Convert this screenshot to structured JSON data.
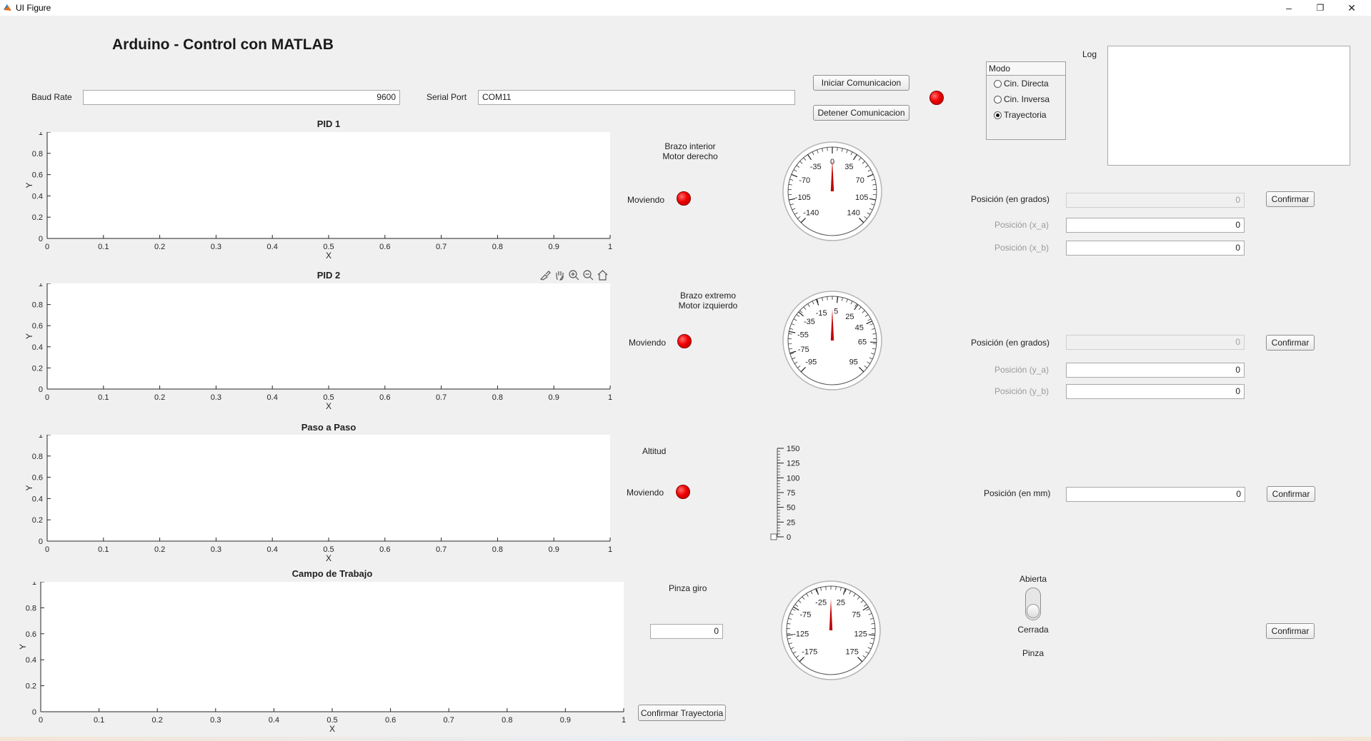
{
  "window": {
    "title": "UI Figure",
    "controls": {
      "minimize": "–",
      "maximize": "❐",
      "close": "✕"
    }
  },
  "app_title": "Arduino - Control con MATLAB",
  "connection": {
    "baud_label": "Baud Rate",
    "baud_value": "9600",
    "port_label": "Serial Port",
    "port_value": "COM11",
    "start_button": "Iniciar Comunicacion",
    "stop_button": "Detener Comunicacion"
  },
  "mode_panel": {
    "title": "Modo",
    "options": [
      "Cin. Directa",
      "Cin. Inversa",
      "Trayectoria"
    ],
    "selected": "Trayectoria"
  },
  "log": {
    "label": "Log",
    "content": ""
  },
  "plots": [
    {
      "title": "PID 1",
      "xlabel": "X",
      "ylabel": "Y"
    },
    {
      "title": "PID 2",
      "xlabel": "X",
      "ylabel": "Y"
    },
    {
      "title": "Paso a Paso",
      "xlabel": "X",
      "ylabel": "Y"
    },
    {
      "title": "Campo de Trabajo",
      "xlabel": "X",
      "ylabel": "Y"
    }
  ],
  "chart_data": [
    {
      "type": "line",
      "title": "PID 1",
      "xlabel": "X",
      "ylabel": "Y",
      "xlim": [
        0,
        1
      ],
      "ylim": [
        0,
        1
      ],
      "series": [],
      "xticks": [
        "0",
        "0.1",
        "0.2",
        "0.3",
        "0.4",
        "0.5",
        "0.6",
        "0.7",
        "0.8",
        "0.9",
        "1"
      ],
      "yticks": [
        "0",
        "0.2",
        "0.4",
        "0.6",
        "0.8",
        "1"
      ]
    },
    {
      "type": "line",
      "title": "PID 2",
      "xlabel": "X",
      "ylabel": "Y",
      "xlim": [
        0,
        1
      ],
      "ylim": [
        0,
        1
      ],
      "series": [],
      "xticks": [
        "0",
        "0.1",
        "0.2",
        "0.3",
        "0.4",
        "0.5",
        "0.6",
        "0.7",
        "0.8",
        "0.9",
        "1"
      ],
      "yticks": [
        "0",
        "0.2",
        "0.4",
        "0.6",
        "0.8",
        "1"
      ]
    },
    {
      "type": "line",
      "title": "Paso a Paso",
      "xlabel": "X",
      "ylabel": "Y",
      "xlim": [
        0,
        1
      ],
      "ylim": [
        0,
        1
      ],
      "series": [],
      "xticks": [
        "0",
        "0.1",
        "0.2",
        "0.3",
        "0.4",
        "0.5",
        "0.6",
        "0.7",
        "0.8",
        "0.9",
        "1"
      ],
      "yticks": [
        "0",
        "0.2",
        "0.4",
        "0.6",
        "0.8",
        "1"
      ]
    },
    {
      "type": "line",
      "title": "Campo de Trabajo",
      "xlabel": "X",
      "ylabel": "Y",
      "xlim": [
        0,
        1
      ],
      "ylim": [
        0,
        1
      ],
      "series": [],
      "xticks": [
        "0",
        "0.1",
        "0.2",
        "0.3",
        "0.4",
        "0.5",
        "0.6",
        "0.7",
        "0.8",
        "0.9",
        "1"
      ],
      "yticks": [
        "0",
        "0.2",
        "0.4",
        "0.6",
        "0.8",
        "1"
      ]
    }
  ],
  "axes_toolbar": [
    "brush-icon",
    "pan-icon",
    "zoom-in-icon",
    "zoom-out-icon",
    "home-icon"
  ],
  "motors": {
    "inner": {
      "label_line1": "Brazo interior",
      "label_line2": "Motor derecho",
      "status": "Moviendo"
    },
    "outer": {
      "label_line1": "Brazo extremo",
      "label_line2": "Motor izquierdo",
      "status": "Moviendo"
    },
    "altitude": {
      "label": "Altitud",
      "status": "Moviendo"
    },
    "gripper_rotation": {
      "label": "Pinza giro",
      "value": "0"
    }
  },
  "gauges": [
    {
      "min": -140,
      "max": 140,
      "value": 0,
      "labels": [
        "-140",
        "-105",
        "-70",
        "-35",
        "0",
        "35",
        "70",
        "105",
        "140"
      ]
    },
    {
      "min": -95,
      "max": 95,
      "value": 0,
      "labels": [
        "-95",
        "-75",
        "-55",
        "-35",
        "-15",
        "5",
        "25",
        "45",
        "65",
        "95"
      ]
    },
    {
      "min": -175,
      "max": 175,
      "value": 0,
      "labels": [
        "-175",
        "-125",
        "-75",
        "-25",
        "25",
        "75",
        "125",
        "175"
      ]
    }
  ],
  "altitude_gauge": {
    "min": 0,
    "max": 150,
    "value": 0,
    "labels": [
      "0",
      "25",
      "50",
      "75",
      "100",
      "125",
      "150"
    ]
  },
  "section1": {
    "pos_deg_label": "Posición (en grados)",
    "pos_deg_value": "0",
    "pos_a_label": "Posición (x_a)",
    "pos_a_value": "0",
    "pos_b_label": "Posición (x_b)",
    "pos_b_value": "0",
    "confirm": "Confirmar"
  },
  "section2": {
    "pos_deg_label": "Posición (en grados)",
    "pos_deg_value": "0",
    "pos_a_label": "Posición (y_a)",
    "pos_a_value": "0",
    "pos_b_label": "Posición (y_b)",
    "pos_b_value": "0",
    "confirm": "Confirmar"
  },
  "section3": {
    "pos_mm_label": "Posición (en mm)",
    "pos_mm_value": "0",
    "confirm": "Confirmar"
  },
  "gripper": {
    "on_label": "Abierta",
    "off_label": "Cerrada",
    "label": "Pinza",
    "state": "Cerrada",
    "confirm": "Confirmar"
  },
  "trajectory_button": "Confirmar Trayectoria",
  "colors": {
    "lamp": "#ef0000",
    "needle": "#c00000",
    "background": "#f0f0f0"
  }
}
